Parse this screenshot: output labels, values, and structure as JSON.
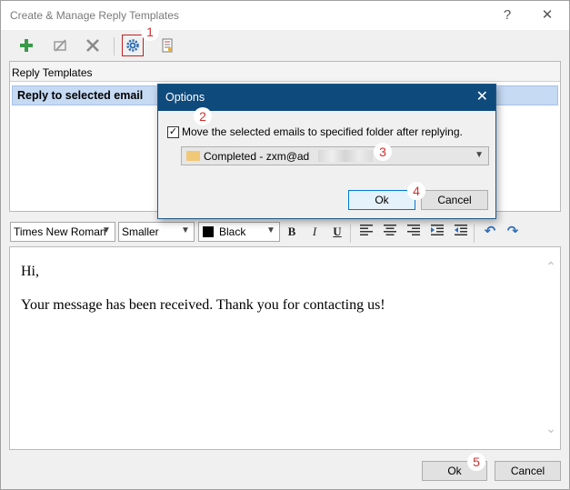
{
  "window": {
    "title": "Create & Manage Reply Templates",
    "help_glyph": "?",
    "close_glyph": "✕"
  },
  "toolbar": {
    "icons": [
      "add-icon",
      "edit-disabled-icon",
      "delete-icon",
      "settings-gear-icon",
      "template-list-icon"
    ]
  },
  "list": {
    "header": "Reply Templates",
    "items": [
      {
        "label": "Reply to selected email"
      }
    ]
  },
  "format_bar": {
    "font": "Times New Roman",
    "size": "Smaller",
    "color": "Black",
    "color_hex": "#000000",
    "bold": "B",
    "italic": "I",
    "underline": "U"
  },
  "editor": {
    "lines": [
      "Hi,",
      "Your message has been received. Thank you for contacting us!"
    ]
  },
  "footer": {
    "ok_label": "Ok",
    "cancel_label": "Cancel"
  },
  "options_dialog": {
    "title": "Options",
    "close_glyph": "✕",
    "checkbox_label": "Move the selected emails to specified folder after replying.",
    "checkbox_checked": true,
    "folder_value": "Completed - zxm@ad",
    "ok_label": "Ok",
    "cancel_label": "Cancel"
  },
  "callouts": [
    "1",
    "2",
    "3",
    "4",
    "5"
  ],
  "colors": {
    "dialog_title_bg": "#0f4a7c",
    "selection_bg": "#c6daf4",
    "callout_text": "#d03030"
  }
}
